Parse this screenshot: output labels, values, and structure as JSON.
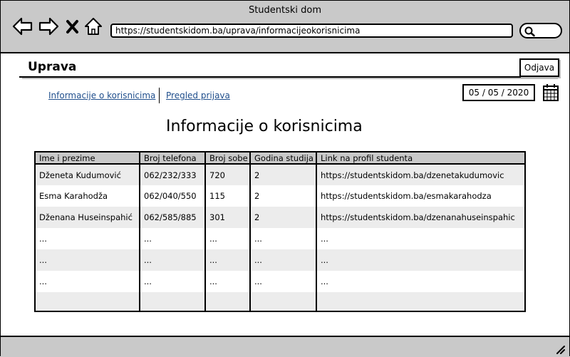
{
  "window": {
    "title": "Studentski dom"
  },
  "browser": {
    "url": "https://studentskidom.ba/uprava/informacijeokorisnicima",
    "back_icon": "arrow-left-icon",
    "forward_icon": "arrow-right-icon",
    "close_icon": "close-icon",
    "home_icon": "home-icon",
    "search_icon": "search-icon"
  },
  "header": {
    "title": "Uprava",
    "logout_label": "Odjava"
  },
  "tabs": [
    {
      "label": "Informacije o korisnicima"
    },
    {
      "label": "Pregled prijava"
    }
  ],
  "date": "05 / 05 / 2020",
  "main": {
    "heading": "Informacije o korisnicima",
    "table": {
      "columns": [
        "Ime i prezime",
        "Broj telefona",
        "Broj sobe",
        "Godina studija",
        "Link na profil studenta"
      ],
      "rows": [
        [
          "Dženeta Kudumović",
          "062/232/333",
          "720",
          "2",
          "https://studentskidom.ba/dzenetakudumovic"
        ],
        [
          "Esma Karahodža",
          "062/040/550",
          "115",
          "2",
          "https://studentskidom.ba/esmakarahodza"
        ],
        [
          "Dženana Huseinspahić",
          "062/585/885",
          "301",
          "2",
          "https://studentskidom.ba/dzenanahuseinspahic"
        ],
        [
          "...",
          "...",
          "...",
          "...",
          "..."
        ],
        [
          "...",
          "...",
          "...",
          "...",
          "..."
        ],
        [
          "...",
          "...",
          "...",
          "...",
          "..."
        ],
        [
          "",
          "",
          "",
          "",
          ""
        ]
      ]
    }
  }
}
